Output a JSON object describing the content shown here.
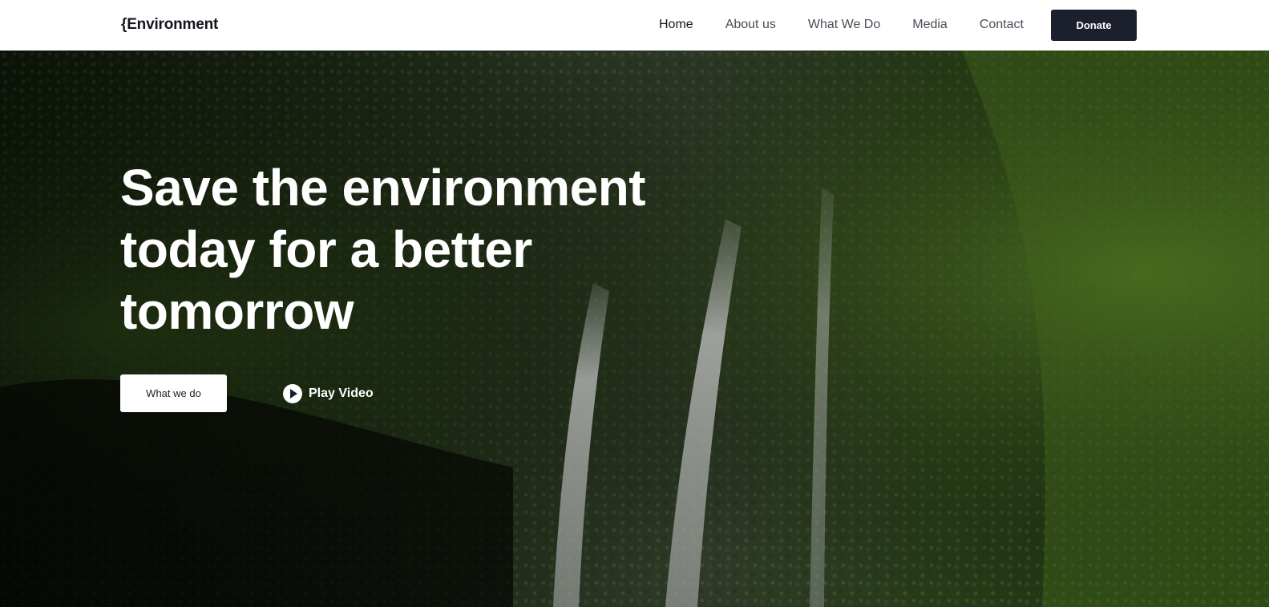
{
  "brand": {
    "logo_text": "{Environment"
  },
  "nav": {
    "items": [
      {
        "label": "Home",
        "active": true
      },
      {
        "label": "About us",
        "active": false
      },
      {
        "label": "What We Do",
        "active": false
      },
      {
        "label": "Media",
        "active": false
      },
      {
        "label": "Contact",
        "active": false
      }
    ],
    "donate_label": "Donate"
  },
  "hero": {
    "headline_line1": "Save the environment",
    "headline_line2": "today for a better",
    "headline_line3": "tomorrow",
    "primary_cta_label": "What we do",
    "secondary_cta_label": "Play Video",
    "background": "forest waterfall photo"
  },
  "colors": {
    "navbar_bg": "#ffffff",
    "donate_bg": "#1c1f2c",
    "text_dark": "#14161f",
    "text_light": "#ffffff"
  },
  "icons": {
    "play": "play-circle-icon"
  }
}
